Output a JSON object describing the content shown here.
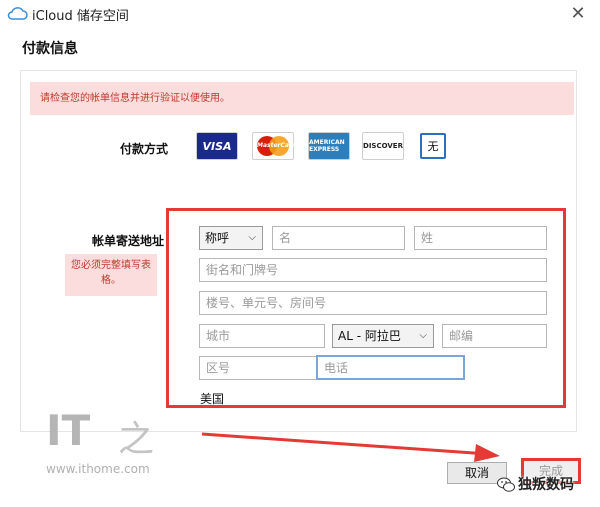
{
  "window": {
    "title": "iCloud 储存空间",
    "close_symbol": "✕"
  },
  "header": {
    "title": "付款信息"
  },
  "warning_text": "请检查您的帐单信息并进行验证以便使用。",
  "payment": {
    "label": "付款方式",
    "cards": [
      "VISA",
      "MasterCard",
      "AMERICAN EXPRESS",
      "DISCOVER"
    ],
    "none_label": "无"
  },
  "billing": {
    "label": "帐单寄送地址",
    "required_note": "您必须完整填写表格。",
    "salutation": "称呼",
    "first_name_placeholder": "名",
    "last_name_placeholder": "姓",
    "street_placeholder": "街名和门牌号",
    "unit_placeholder": "楼号、单元号、房间号",
    "city_placeholder": "城市",
    "state_value": "AL - 阿拉巴",
    "zip_placeholder": "邮编",
    "area_code_placeholder": "区号",
    "phone_placeholder": "电话",
    "country": "美国"
  },
  "buttons": {
    "cancel": "取消",
    "done": "完成"
  },
  "watermark": {
    "logo": "IT",
    "url": "www.ithome.com"
  },
  "overlay": {
    "wechat_text": "独叛数码"
  },
  "colors": {
    "warning_bg": "#fbdddd",
    "warning_text": "#c0392b",
    "highlight_red": "#e53935",
    "focus_blue": "#7aa7d8"
  }
}
